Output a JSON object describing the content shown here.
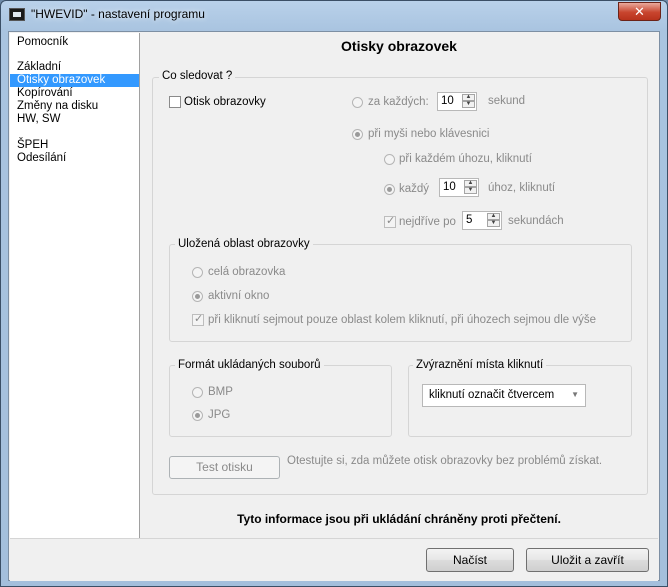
{
  "window": {
    "title": "\"HWEVID\" - nastavení programu",
    "close_glyph": "✕"
  },
  "sidebar": {
    "items": [
      {
        "label": "Pomocník"
      },
      {
        "label": "Základní"
      },
      {
        "label": "Otisky obrazovek"
      },
      {
        "label": "Kopírování"
      },
      {
        "label": "Změny na disku"
      },
      {
        "label": "HW, SW"
      },
      {
        "label": "ŠPEH"
      },
      {
        "label": "Odesílání"
      }
    ],
    "selected": "Otisky obrazovek"
  },
  "page": {
    "title": "Otisky obrazovek",
    "what_to_track": {
      "legend": "Co sledovat ?",
      "screenshot_checkbox": {
        "label": "Otisk obrazovky",
        "checked": false
      },
      "every_radio": {
        "label": "za každých:",
        "selected": false
      },
      "every_value": "10",
      "every_unit": "sekund",
      "mouse_kb_radio": {
        "label": "při myši nebo klávesnici",
        "selected": true
      },
      "each_click_radio": {
        "label": "při každém úhozu, kliknutí",
        "selected": false
      },
      "each_n_radio": {
        "label": "každý",
        "selected": true
      },
      "each_n_value": "10",
      "each_n_unit": "úhoz, kliknutí",
      "first_after_checkbox": {
        "label": "nejdříve po",
        "checked": true
      },
      "first_after_value": "5",
      "first_after_unit": "sekundách"
    },
    "saved_area": {
      "legend": "Uložená oblast obrazovky",
      "full_screen": {
        "label": "celá obrazovka",
        "selected": false
      },
      "active_window": {
        "label": "aktivní okno",
        "selected": true
      },
      "click_area": {
        "label": "při kliknutí sejmout pouze oblast kolem kliknutí, při úhozech sejmou dle výše",
        "checked": true
      }
    },
    "file_format": {
      "legend": "Formát ukládaných souborů",
      "bmp": {
        "label": "BMP",
        "selected": false
      },
      "jpg": {
        "label": "JPG",
        "selected": true
      }
    },
    "click_highlight": {
      "legend": "Zvýraznění místa kliknutí",
      "selected": "kliknutí označit čtvercem"
    },
    "test_button": "Test otisku",
    "test_hint": "Otestujte si, zda můžete otisk obrazovky bez problémů získat.",
    "info": "Tyto informace jsou při ukládání chráněny proti přečtení."
  },
  "footer": {
    "load_button": "Načíst",
    "save_close_button": "Uložit a zavřít"
  }
}
